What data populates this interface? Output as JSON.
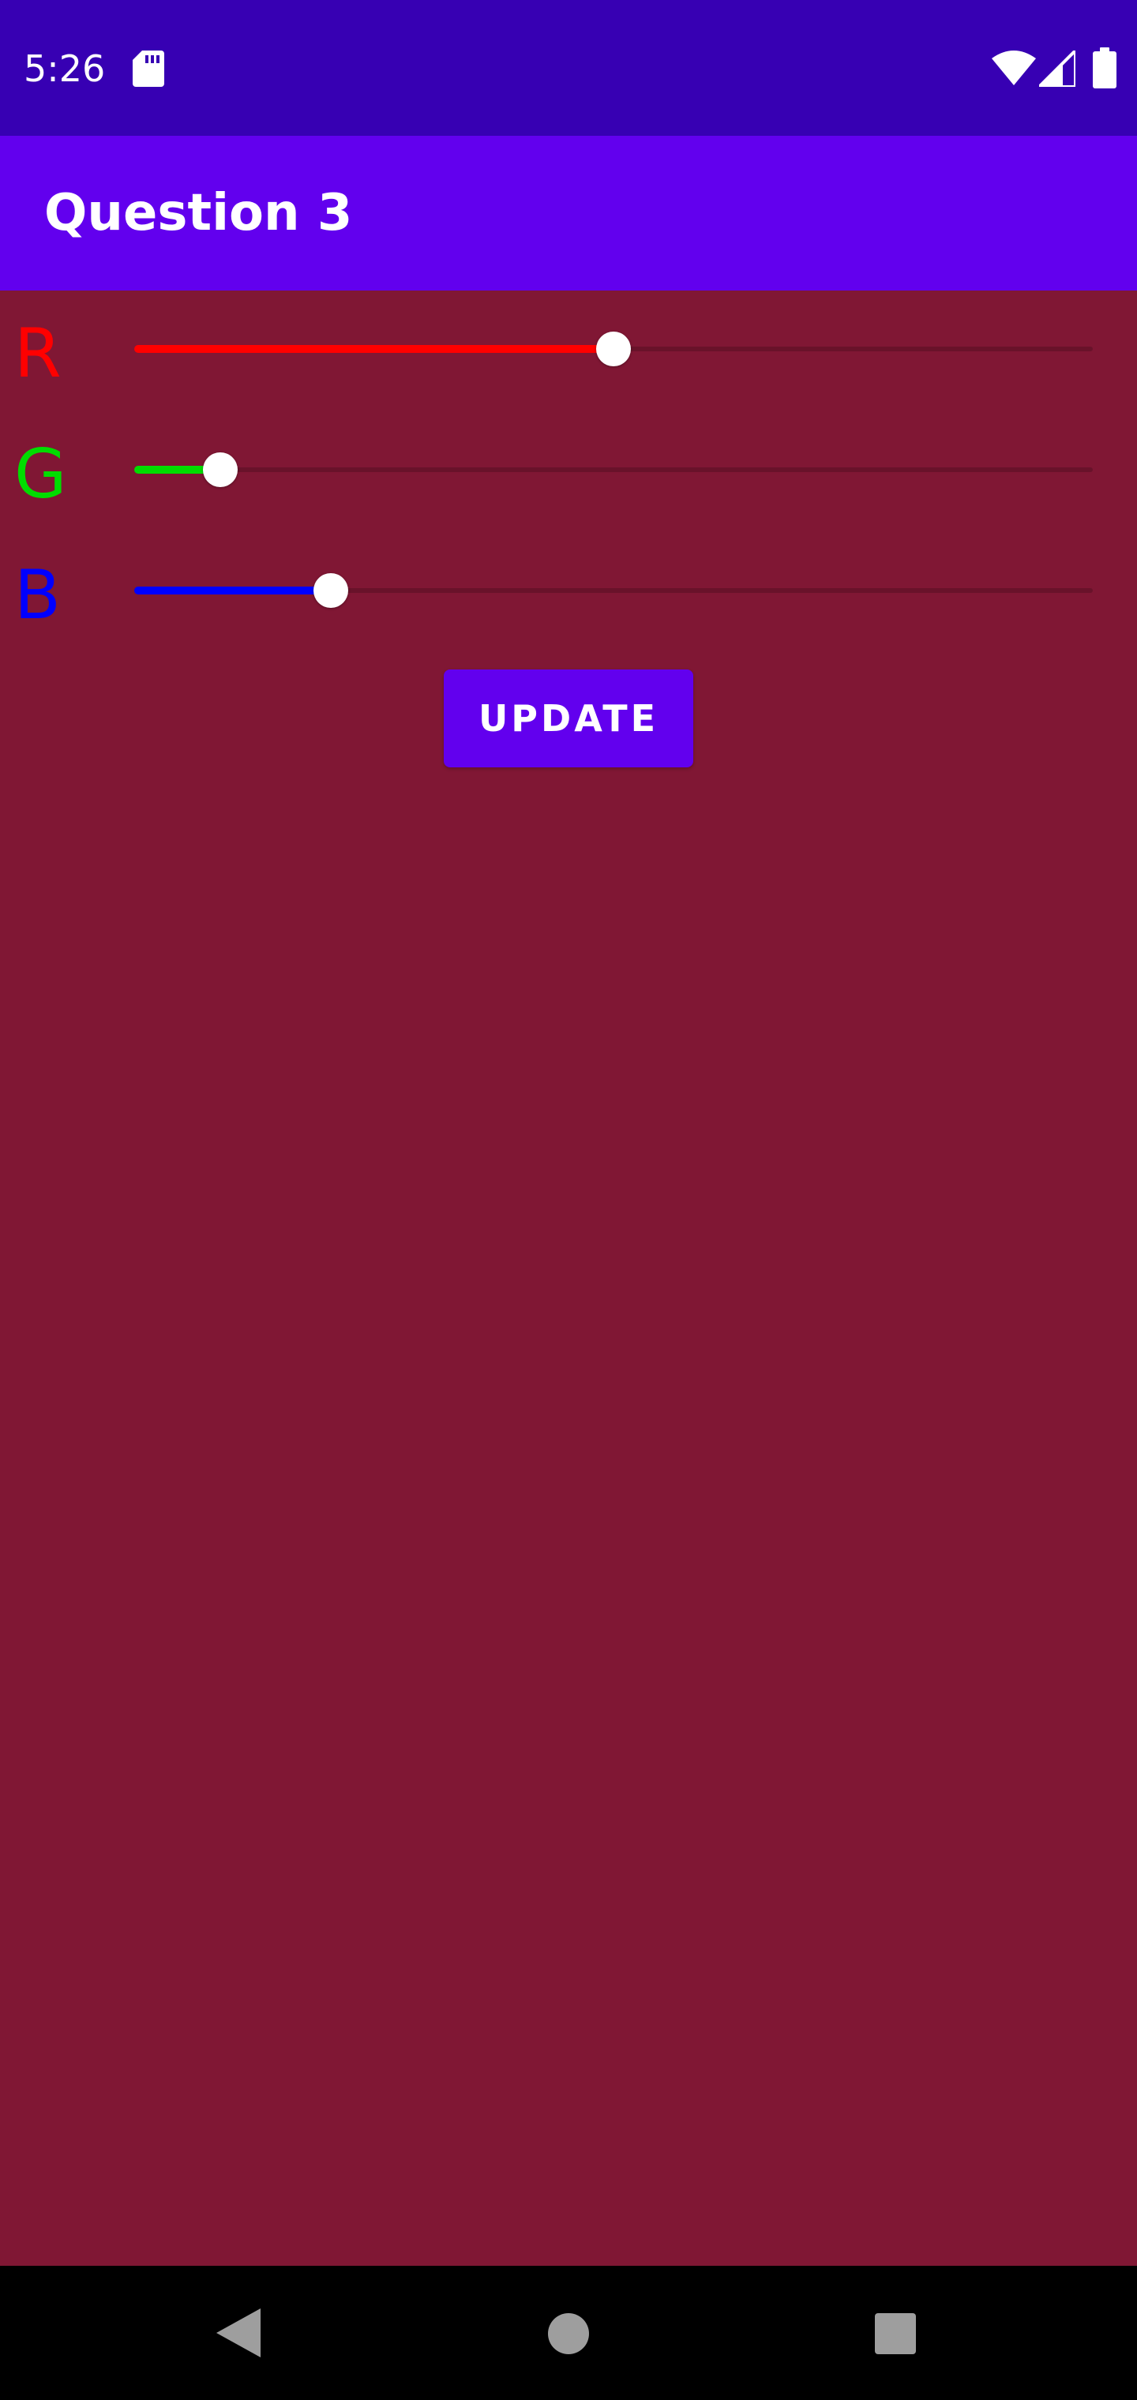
{
  "status_bar": {
    "time": "5:26",
    "icons": [
      "sd-card-icon",
      "wifi-icon",
      "cell-signal-icon",
      "battery-icon"
    ]
  },
  "app_bar": {
    "title": "Question 3"
  },
  "sliders": [
    {
      "label": "R",
      "color": "#FF0000",
      "value_fraction": 0.5
    },
    {
      "label": "G",
      "color": "#00DD00",
      "value_fraction": 0.09
    },
    {
      "label": "B",
      "color": "#0000FF",
      "value_fraction": 0.205
    }
  ],
  "update_button": {
    "label": "UPDATE"
  },
  "background_color": "#801734",
  "nav_bar": {
    "icons": [
      "back-icon",
      "home-icon",
      "recents-icon"
    ]
  }
}
